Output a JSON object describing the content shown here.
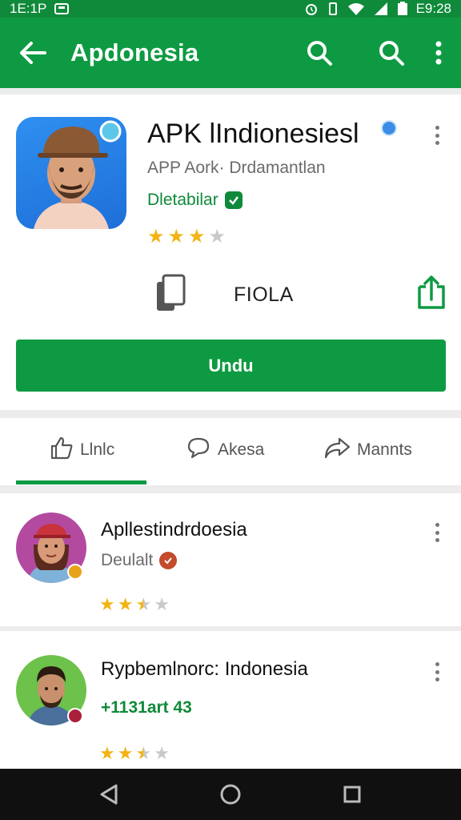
{
  "status_bar": {
    "time_left": "1E:1P",
    "time_right": "E9:28"
  },
  "app_bar": {
    "title": "Apdonesia",
    "icons": [
      "back-arrow-icon",
      "search-icon",
      "search-icon",
      "more-vert-icon"
    ]
  },
  "app_detail": {
    "name": "APK lIndionesiesl",
    "developer": "APP Aork· Drdamantlan",
    "status": "Dletabilar",
    "rating_stars": 3,
    "size_label": "FIOLA",
    "download_label": "Undu",
    "colors": {
      "brand": "#0e9a42",
      "star": "#f2b315"
    }
  },
  "tabs": [
    {
      "label": "Llnlc",
      "icon": "thumbs-up-icon"
    },
    {
      "label": "Akesa",
      "icon": "chat-bubble-icon"
    },
    {
      "label": "Mannts",
      "icon": "share-arrow-icon"
    }
  ],
  "list": [
    {
      "title": "Apllestindrdoesia",
      "subtitle": "Deulalt",
      "rating_stars": 2.5
    },
    {
      "title": "Rypbemlnorc: Indonesia",
      "subtitle": "+1131art 43",
      "rating_stars": 2.5
    }
  ]
}
